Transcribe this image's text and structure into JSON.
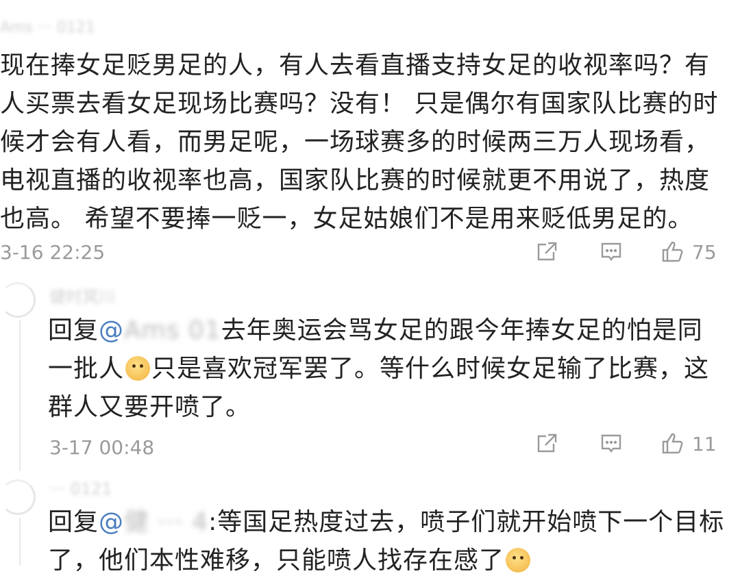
{
  "main": {
    "user": "Ams  ··· 0121",
    "text": "现在捧女足贬男足的人，有人去看直播支持女足的收视率吗？有人买票去看女足现场比赛吗？没有！ 只是偶尔有国家队比赛的时候才会有人看，而男足呢，一场球赛多的时候两三万人现场看，电视直播的收视率也高，国家队比赛的时候就更不用说了，热度也高。 希望不要捧一贬一，女足姑娘们不是用来贬低男足的。",
    "time": "3-16 22:25",
    "likes": "75"
  },
  "replies": [
    {
      "user": "健时冥川",
      "reply_prefix": "回复",
      "mention_symbol": "@",
      "mention_hidden": "Ams   01",
      "text_after": "去年奥运会骂女足的跟今年捧女足的怕是同一批人",
      "text_after_emoji": "只是喜欢冠军罢了。等什么时候女足输了比赛，这群人又要开喷了。",
      "emoji": "doge-face",
      "time": "3-17 00:48",
      "likes": "11"
    },
    {
      "user": "··· 0121",
      "reply_prefix": "回复",
      "mention_symbol": "@",
      "mention_hidden": "健 ···  4",
      "text_after": ":等国足热度过去，喷子们就开始喷下一个目标了，他们本性难移，只能喷人找存在感了",
      "emoji": "laugh-cry-face"
    }
  ],
  "icons": [
    "share-icon",
    "comment-icon",
    "like-icon"
  ]
}
